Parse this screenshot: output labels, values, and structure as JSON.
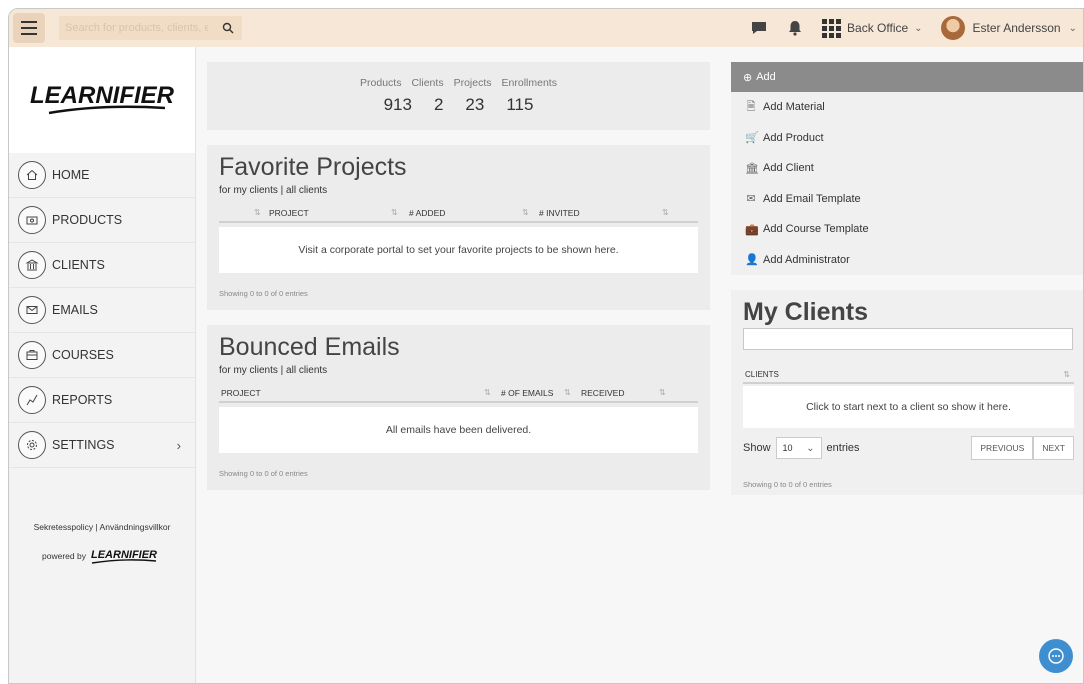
{
  "topbar": {
    "search_placeholder": "Search for products, clients, etc.",
    "backoffice_label": "Back Office",
    "user_name": "Ester Andersson"
  },
  "sidebar": {
    "logo_text": "LEARNIFIER",
    "items": [
      {
        "label": "HOME",
        "icon": "home-icon"
      },
      {
        "label": "PRODUCTS",
        "icon": "product-icon"
      },
      {
        "label": "CLIENTS",
        "icon": "bank-icon"
      },
      {
        "label": "EMAILS",
        "icon": "envelope-icon"
      },
      {
        "label": "COURSES",
        "icon": "briefcase-icon"
      },
      {
        "label": "REPORTS",
        "icon": "chart-line-icon"
      },
      {
        "label": "SETTINGS",
        "icon": "gear-icon"
      }
    ],
    "footer_links": "Sekretesspolicy | Användningsvillkor",
    "powered_by": "powered by",
    "footer_logo": "LEARNIFIER"
  },
  "stats": {
    "labels": [
      "Products",
      "Clients",
      "Projects",
      "Enrollments"
    ],
    "values": [
      "913",
      "2",
      "23",
      "115"
    ]
  },
  "favorites": {
    "title": "Favorite Projects",
    "subtitle": "for my clients | all clients",
    "columns": [
      "PROJECT",
      "# ADDED",
      "# INVITED"
    ],
    "empty_message": "Visit a corporate portal to set your favorite projects to be shown here.",
    "showing": "Showing 0 to 0 of 0 entries"
  },
  "bounced": {
    "title": "Bounced Emails",
    "subtitle": "for my clients | all clients",
    "columns": [
      "PROJECT",
      "# OF EMAILS",
      "RECEIVED"
    ],
    "empty_message": "All emails have been delivered.",
    "showing": "Showing 0 to 0 of 0 entries"
  },
  "add_menu": {
    "header": "Add",
    "items": [
      "Add Material",
      "Add Product",
      "Add Client",
      "Add Email Template",
      "Add Course Template",
      "Add Administrator"
    ]
  },
  "clients": {
    "title": "My Clients",
    "column": "CLIENTS",
    "empty_message": "Click to start next to a client so show it here.",
    "show_label": "Show",
    "page_size": "10",
    "entries_label": "entries",
    "prev": "PREVIOUS",
    "next": "NEXT",
    "showing": "Showing 0 to 0 of 0 entries"
  },
  "colors": {
    "topbar": "#f6e7d6",
    "add_header": "#8b8b8b",
    "chat": "#3f8fd0"
  }
}
